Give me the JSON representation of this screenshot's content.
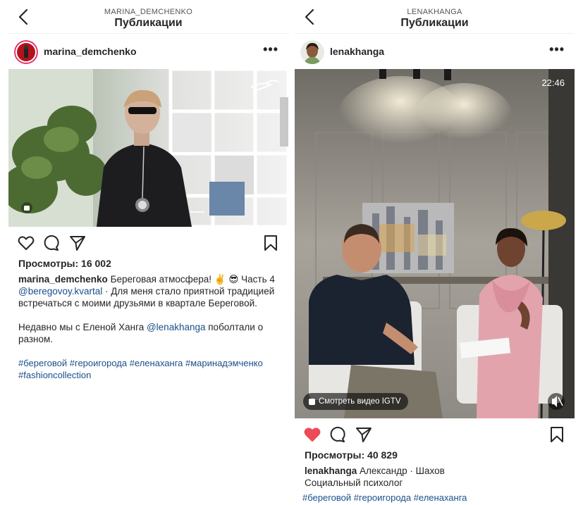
{
  "left": {
    "header_user": "MARINA_DEMCHENKO",
    "header_title": "Публикации",
    "username": "marina_demchenko",
    "more": "•••",
    "views": "Просмотры: 16 002",
    "caption_user": "marina_demchenko",
    "caption_text": "Береговая атмосфера! ✌️ 😎 Часть 4",
    "caption_mention": "@beregovoy.kvartal",
    "caption_text2": " · Для меня стало приятной традицией встречаться с моими друзьями в квартале Береговой.",
    "para2_text": "Недавно мы с Еленой Ханга ",
    "para2_mention": "@lenakhanga",
    "para2_text2": " поболтали о разном.",
    "hashtags": "#береговой #героигорода #еленаханга #маринадэмченко #fashioncollection"
  },
  "right": {
    "header_user": "LENAKHANGA",
    "header_title": "Публикации",
    "username": "lenakhanga",
    "more": "•••",
    "timestamp": "22:46",
    "igtv_label": "Смотреть видео IGTV",
    "views": "Просмотры: 40 829",
    "caption_user": "lenakhanga",
    "caption_text": "Александр · Шахов",
    "caption_line2": "Социальный психолог",
    "hashtags": "#береговой #героигорода #еленаханга"
  },
  "colors": {
    "like_active": "#ed4956",
    "link": "#1a4f8b"
  }
}
